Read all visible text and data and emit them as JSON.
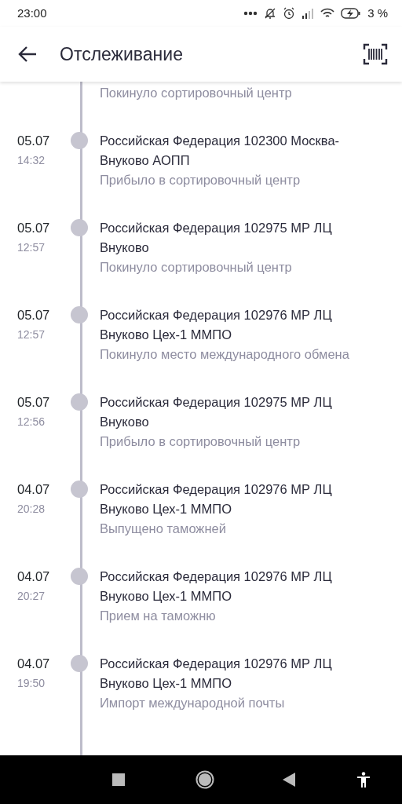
{
  "status_bar": {
    "time": "23:00",
    "battery_text": "3 %"
  },
  "header": {
    "title": "Отслеживание"
  },
  "events": [
    {
      "status": "Покинуло сортировочный центр"
    },
    {
      "date": "05.07",
      "time": "14:32",
      "location": "Российская Федерация 102300 Москва-Внуково АОПП",
      "status": "Прибыло в сортировочный центр"
    },
    {
      "date": "05.07",
      "time": "12:57",
      "location": "Российская Федерация 102975 МР ЛЦ Внуково",
      "status": "Покинуло сортировочный центр"
    },
    {
      "date": "05.07",
      "time": "12:57",
      "location": "Российская Федерация 102976 МР ЛЦ Внуково Цех-1 ММПО",
      "status": "Покинуло место международного обмена"
    },
    {
      "date": "05.07",
      "time": "12:56",
      "location": "Российская Федерация 102975 МР ЛЦ Внуково",
      "status": "Прибыло в сортировочный центр"
    },
    {
      "date": "04.07",
      "time": "20:28",
      "location": "Российская Федерация 102976 МР ЛЦ Внуково Цех-1 ММПО",
      "status": "Выпущено таможней"
    },
    {
      "date": "04.07",
      "time": "20:27",
      "location": "Российская Федерация 102976 МР ЛЦ Внуково Цех-1 ММПО",
      "status": "Прием на таможню"
    },
    {
      "date": "04.07",
      "time": "19:50",
      "location": "Российская Федерация 102976 МР ЛЦ Внуково Цех-1 ММПО",
      "status": "Импорт международной почты"
    }
  ]
}
